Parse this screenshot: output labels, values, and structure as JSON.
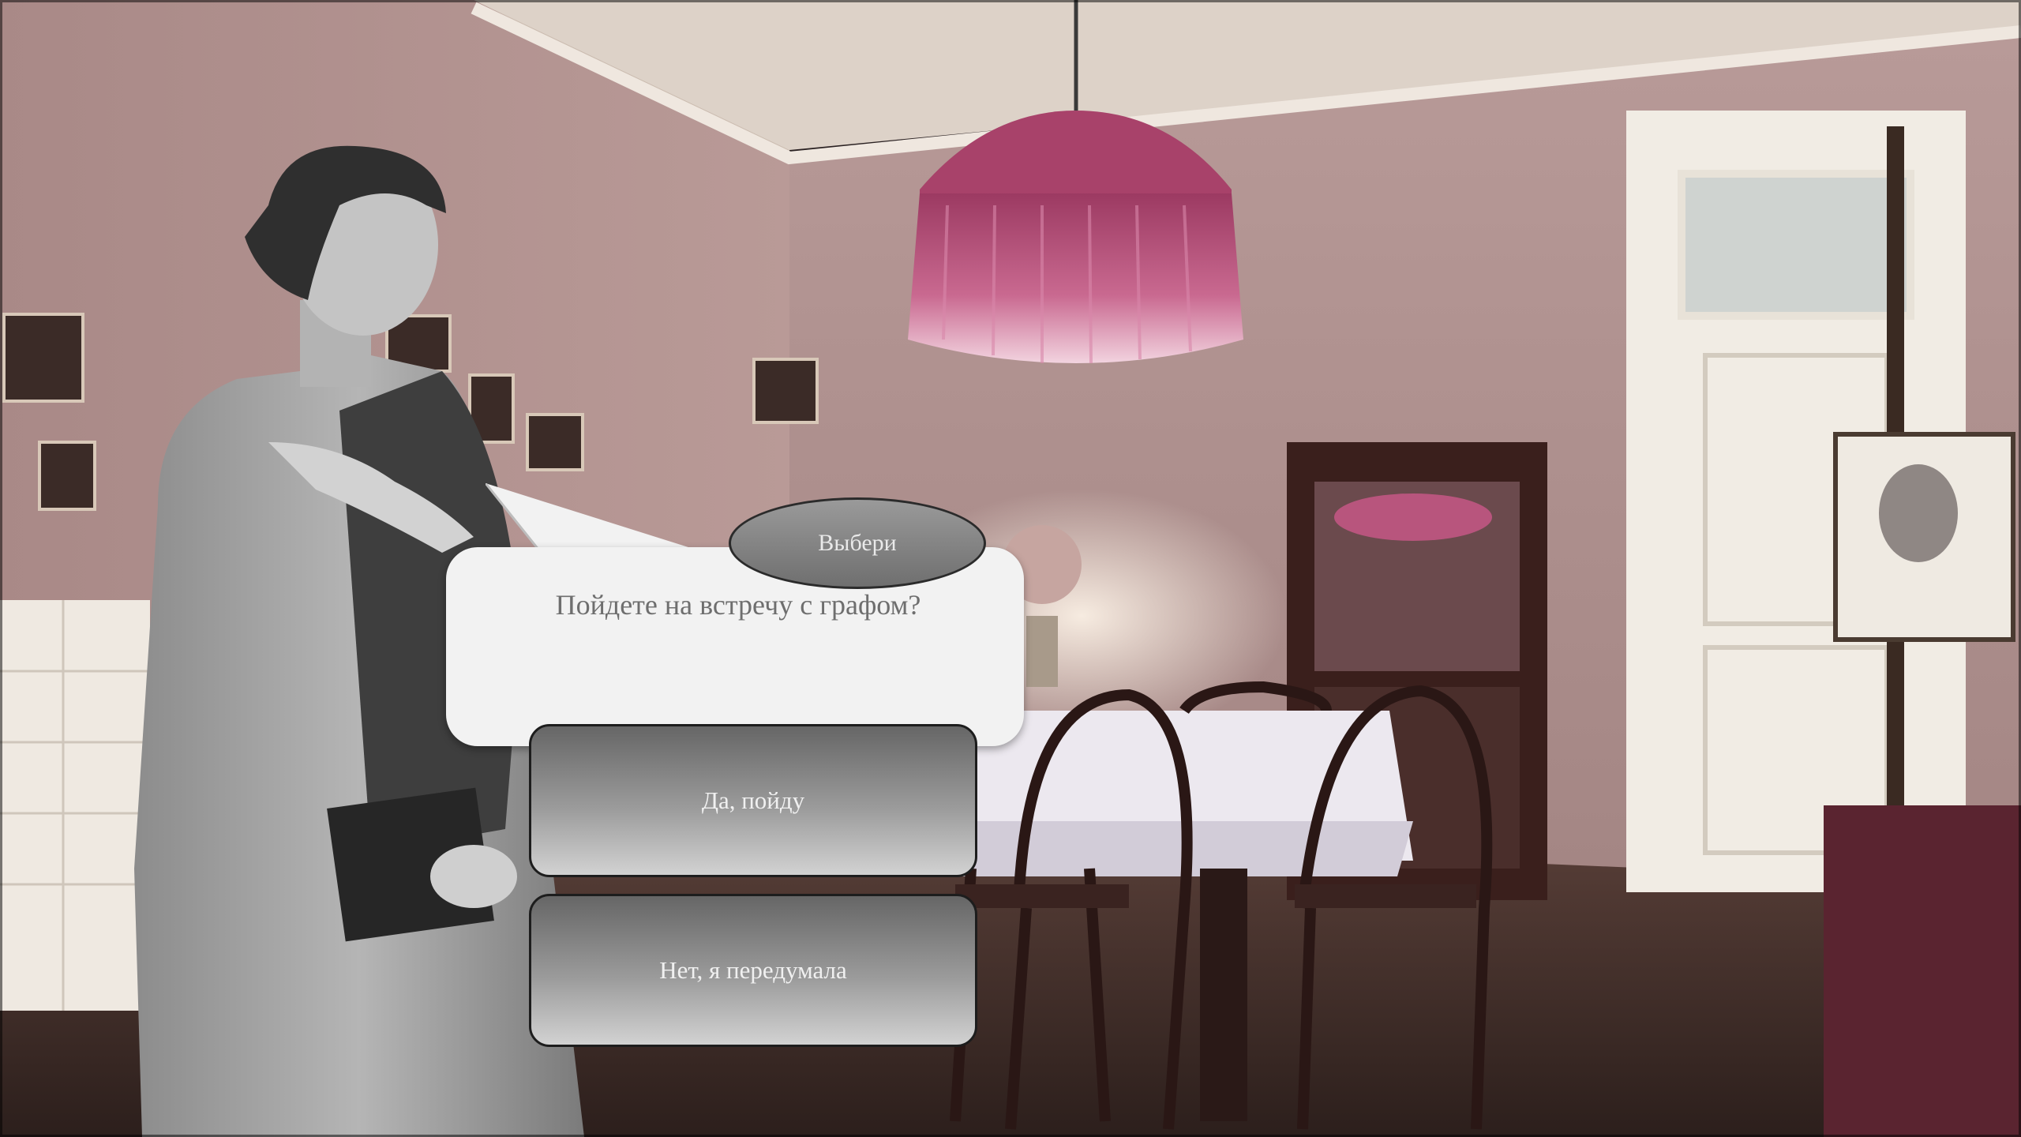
{
  "scene": {
    "description_icons": [
      "pink-lamp",
      "dining-table",
      "cabinet",
      "easel-portrait",
      "woman-figure"
    ]
  },
  "dialog": {
    "title": "Выбери",
    "question": "Пойдете на встречу с графом?",
    "choices": [
      {
        "label": "Да, пойду"
      },
      {
        "label": "Нет, я передумала"
      }
    ]
  },
  "colors": {
    "wall": "#b39592",
    "lamp": "#c0577e",
    "floor": "#3a2a26",
    "bubble": "#f2f2f2",
    "button_dark": "#666666",
    "button_light": "#d2d2d2"
  }
}
